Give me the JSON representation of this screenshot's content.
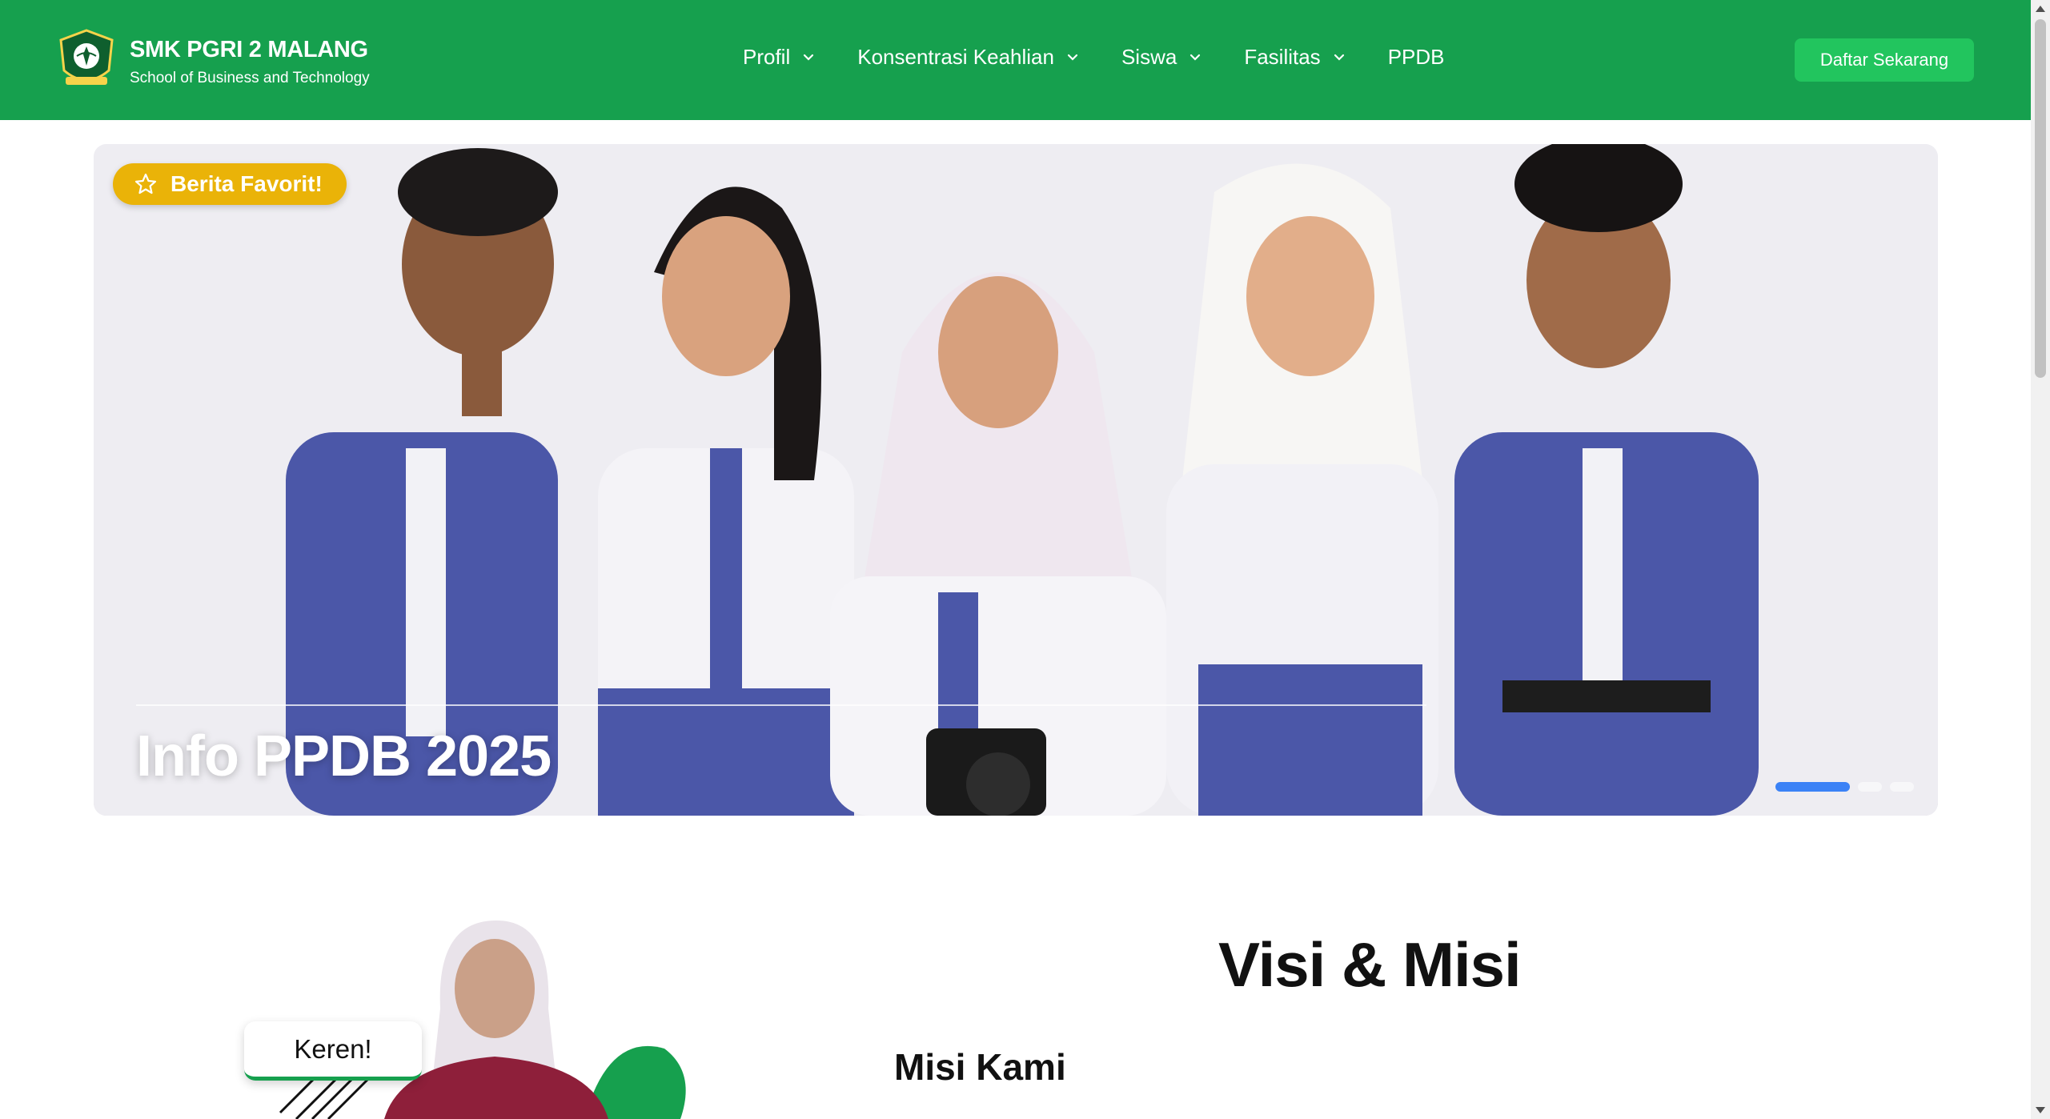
{
  "header": {
    "brand_name": "SMK PGRI 2 MALANG",
    "brand_tagline": "School of Business and Technology",
    "cta_label": "Daftar Sekarang",
    "nav": [
      {
        "label": "Profil",
        "has_dropdown": true
      },
      {
        "label": "Konsentrasi Keahlian",
        "has_dropdown": true
      },
      {
        "label": "Siswa",
        "has_dropdown": true
      },
      {
        "label": "Fasilitas",
        "has_dropdown": true
      },
      {
        "label": "PPDB",
        "has_dropdown": false
      }
    ]
  },
  "hero": {
    "badge_label": "Berita Favorit!",
    "badge_icon": "star-icon",
    "title": "Info PPDB 2025",
    "slide_count": 3,
    "active_slide": 1
  },
  "section": {
    "heading": "Visi & Misi",
    "subheading": "Misi Kami",
    "speech_bubble": "Keren!"
  },
  "colors": {
    "header_green": "#16a04e",
    "cta_green": "#22c55e",
    "badge_yellow": "#eab308",
    "active_dot_blue": "#3b82f6"
  }
}
